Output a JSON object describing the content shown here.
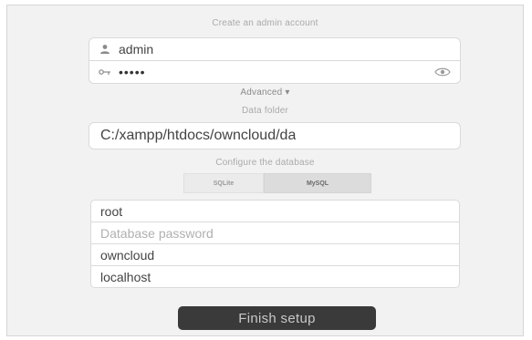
{
  "header": {
    "title": "Create an admin account"
  },
  "admin": {
    "username_value": "admin",
    "password_value": "•••••",
    "username_icon": "user-icon",
    "password_icon": "key-icon",
    "show_password_icon": "eye-icon"
  },
  "advanced": {
    "label": "Advanced ▾"
  },
  "data_folder": {
    "label": "Data folder",
    "value": "C:/xampp/htdocs/owncloud/da"
  },
  "database": {
    "configure_label": "Configure the database",
    "options": [
      "SQLite",
      "MySQL"
    ],
    "selected": "MySQL",
    "fields": {
      "user_value": "root",
      "password_placeholder": "Database password",
      "name_value": "owncloud",
      "host_value": "localhost"
    }
  },
  "footer": {
    "finish_label": "Finish setup"
  },
  "colors": {
    "panel_bg": "#f2f2f2",
    "button_bg": "#3a3a3a",
    "muted_text": "#aaaaaa"
  }
}
